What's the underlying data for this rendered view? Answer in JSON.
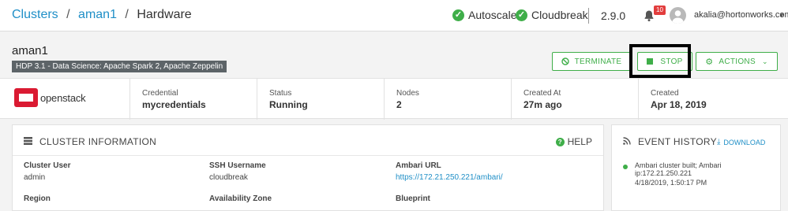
{
  "header": {
    "breadcrumb": {
      "clusters": "Clusters",
      "sep1": "/",
      "cluster": "aman1",
      "sep2": "/",
      "current": "Hardware"
    },
    "autoscale": "Autoscale",
    "cloudbreak": "Cloudbreak",
    "version": "2.9.0",
    "notification_count": "10",
    "user_email": "akalia@hortonworks.com"
  },
  "cluster": {
    "name": "aman1",
    "stack": "HDP 3.1 - Data Science: Apache Spark 2, Apache Zeppelin",
    "actions": {
      "terminate": "TERMINATE",
      "stop": "STOP",
      "actions": "ACTIONS"
    }
  },
  "info": {
    "provider_logo": "openstack",
    "credential": {
      "label": "Credential",
      "value": "mycredentials"
    },
    "status": {
      "label": "Status",
      "value": "Running"
    },
    "nodes": {
      "label": "Nodes",
      "value": "2"
    },
    "created_at": {
      "label": "Created At",
      "value": "27m ago"
    },
    "created": {
      "label": "Created",
      "value": "Apr 18, 2019"
    }
  },
  "cluster_information": {
    "title": "CLUSTER INFORMATION",
    "help": "HELP",
    "fields": [
      {
        "label": "Cluster User",
        "value": "admin"
      },
      {
        "label": "SSH Username",
        "value": "cloudbreak"
      },
      {
        "label": "Ambari URL",
        "value": "https://172.21.250.221/ambari/"
      },
      {
        "label": "Region",
        "value": ""
      },
      {
        "label": "Availability Zone",
        "value": ""
      },
      {
        "label": "Blueprint",
        "value": ""
      }
    ]
  },
  "event_history": {
    "title": "EVENT HISTORY",
    "download": "DOWNLOAD",
    "events": [
      {
        "text": "Ambari cluster built; Ambari ip:172.21.250.221",
        "time": "4/18/2019, 1:50:17 PM"
      }
    ]
  },
  "colors": {
    "accent_green": "#3fae49",
    "link_blue": "#1f8fc7",
    "openstack_red": "#da1a32",
    "badge_red": "#e23d3d"
  }
}
